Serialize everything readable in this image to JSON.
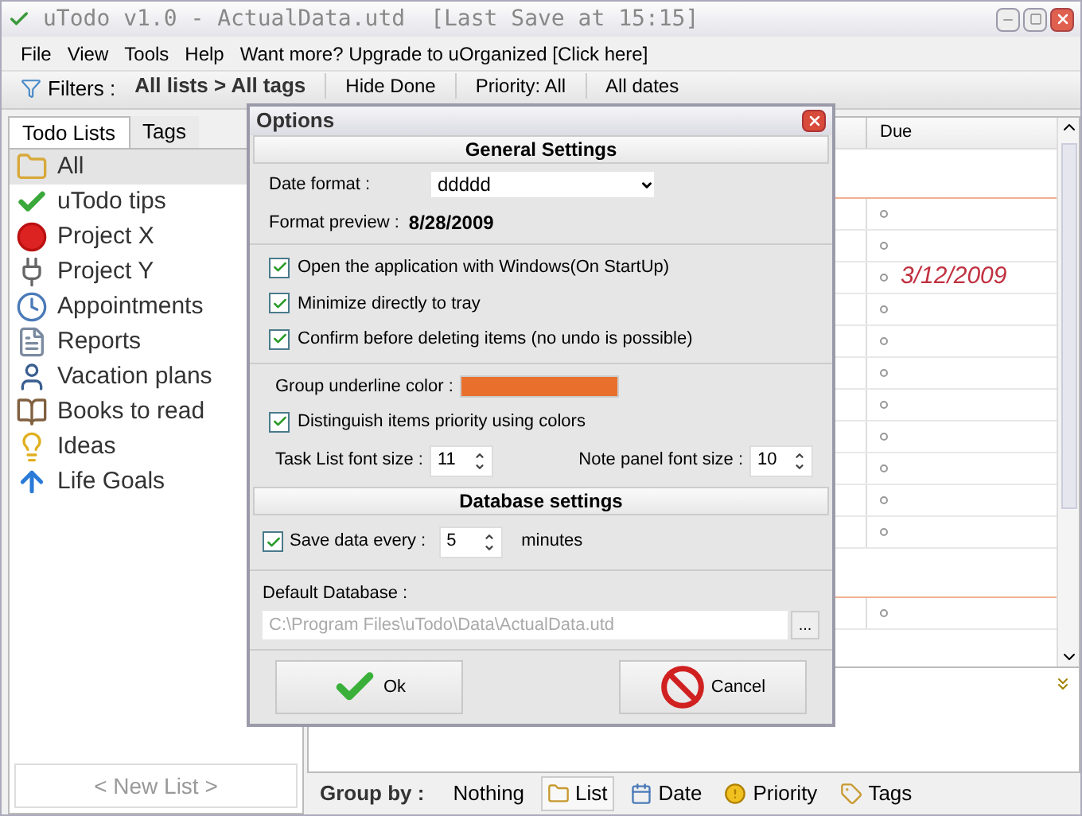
{
  "window": {
    "title": "uTodo v1.0 - ActualData.utd",
    "last_save": "[Last Save at 15:15]"
  },
  "menu": [
    "File",
    "View",
    "Tools",
    "Help",
    "Want more? Upgrade to uOrganized [Click here]"
  ],
  "filters": {
    "label": "Filters :",
    "path": "All lists > All tags",
    "items": [
      "Hide Done",
      "Priority: All",
      "All dates"
    ]
  },
  "sidebar": {
    "tabs": [
      {
        "label": "Todo Lists",
        "selected": true
      },
      {
        "label": "Tags",
        "selected": false
      }
    ],
    "items": [
      {
        "label": "All",
        "selected": true
      },
      {
        "label": "uTodo tips",
        "selected": false
      },
      {
        "label": "Project X",
        "selected": false
      },
      {
        "label": "Project Y",
        "selected": false
      },
      {
        "label": "Appointments",
        "selected": false
      },
      {
        "label": "Reports",
        "selected": false
      },
      {
        "label": "Vacation plans",
        "selected": false
      },
      {
        "label": "Books to read",
        "selected": false
      },
      {
        "label": "Ideas",
        "selected": false
      },
      {
        "label": "Life Goals",
        "selected": false
      }
    ],
    "new_list": "< New List >"
  },
  "table": {
    "columns": [
      "Due"
    ],
    "groups": [
      {
        "rows": [
          {
            "kind": "empty"
          },
          {
            "kind": "empty"
          },
          {
            "kind": "date",
            "due": "3/12/2009"
          },
          {
            "kind": "empty"
          },
          {
            "kind": "empty"
          },
          {
            "kind": "empty"
          },
          {
            "kind": "empty"
          },
          {
            "kind": "empty"
          },
          {
            "kind": "empty"
          },
          {
            "kind": "empty"
          },
          {
            "kind": "empty"
          }
        ]
      },
      {
        "rows": [
          {
            "kind": "empty"
          }
        ]
      }
    ]
  },
  "group_by": {
    "label": "Group by :",
    "options": [
      {
        "label": "Nothing",
        "selected": false
      },
      {
        "label": "List",
        "selected": true
      },
      {
        "label": "Date",
        "selected": false
      },
      {
        "label": "Priority",
        "selected": false
      },
      {
        "label": "Tags",
        "selected": false
      }
    ]
  },
  "dialog": {
    "title": "Options",
    "general_heading": "General Settings",
    "date_format": {
      "label": "Date format :",
      "value": "ddddd"
    },
    "format_preview": {
      "label": "Format preview :",
      "value": "8/28/2009"
    },
    "checks": [
      {
        "label": "Open the application with Windows(On StartUp)",
        "checked": true
      },
      {
        "label": "Minimize directly to tray",
        "checked": true
      },
      {
        "label": "Confirm before deleting items (no undo is possible)",
        "checked": true
      }
    ],
    "group_underline": {
      "label": "Group underline color :",
      "color": "#e8702c"
    },
    "distinguish": {
      "label": "Distinguish items priority using colors",
      "checked": true
    },
    "task_font": {
      "label": "Task List font size :",
      "value": "11"
    },
    "note_font": {
      "label": "Note panel font size :",
      "value": "10"
    },
    "database_heading": "Database settings",
    "save_every": {
      "label": "Save data every :",
      "checked": true,
      "value": "5",
      "unit": "minutes"
    },
    "default_db": {
      "label": "Default Database :",
      "value": "C:\\Program Files\\uTodo\\Data\\ActualData.utd",
      "browse": "...",
      "disabled": true
    },
    "buttons": [
      {
        "kind": "ok",
        "label": "Ok"
      },
      {
        "kind": "cancel",
        "label": "Cancel"
      }
    ]
  }
}
